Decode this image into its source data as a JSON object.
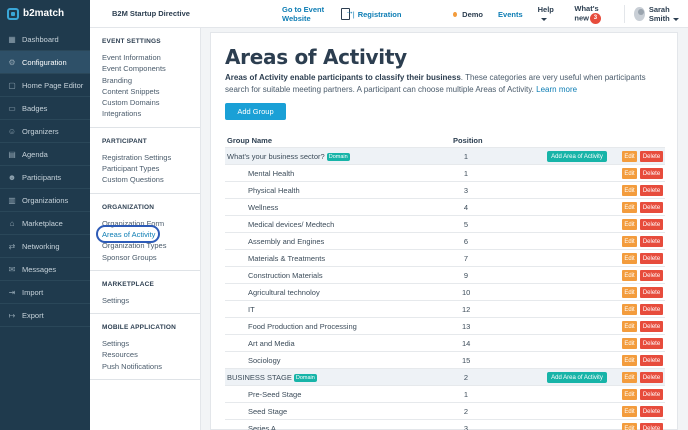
{
  "topbar": {
    "brand": "b2match",
    "event_title": "B2M Startup Directive",
    "go_to_event": "Go to Event Website",
    "registration": "Registration",
    "demo": "Demo",
    "events": "Events",
    "help": "Help",
    "whats_new": "What's new",
    "whats_new_count": "3",
    "user_name": "Sarah Smith"
  },
  "leftnav": {
    "items": [
      {
        "label": "Dashboard",
        "icon": "grid-icon"
      },
      {
        "label": "Configuration",
        "icon": "settings-icon"
      },
      {
        "label": "Home Page Editor",
        "icon": "page-icon"
      },
      {
        "label": "Badges",
        "icon": "badge-icon"
      },
      {
        "label": "Organizers",
        "icon": "people-icon"
      },
      {
        "label": "Agenda",
        "icon": "calendar-icon"
      },
      {
        "label": "Participants",
        "icon": "person-icon"
      },
      {
        "label": "Organizations",
        "icon": "building-icon"
      },
      {
        "label": "Marketplace",
        "icon": "store-icon"
      },
      {
        "label": "Networking",
        "icon": "network-icon"
      },
      {
        "label": "Messages",
        "icon": "mail-icon"
      },
      {
        "label": "Import",
        "icon": "import-icon"
      },
      {
        "label": "Export",
        "icon": "export-icon"
      }
    ]
  },
  "submenu": {
    "event_settings": {
      "title": "EVENT SETTINGS",
      "links": [
        "Event Information",
        "Event Components",
        "Branding",
        "Content Snippets",
        "Custom Domains",
        "Integrations"
      ]
    },
    "participant": {
      "title": "PARTICIPANT",
      "links": [
        "Registration Settings",
        "Participant Types",
        "Custom Questions"
      ]
    },
    "organization": {
      "title": "ORGANIZATION",
      "links": [
        "Organization Form",
        "Areas of Activity",
        "Organization Types",
        "Sponsor Groups"
      ]
    },
    "marketplace": {
      "title": "MARKETPLACE",
      "links": [
        "Settings"
      ]
    },
    "mobile": {
      "title": "MOBILE APPLICATION",
      "links": [
        "Settings",
        "Resources",
        "Push Notifications"
      ]
    }
  },
  "main": {
    "title": "Areas of Activity",
    "desc_bold": "Areas of Activity enable participants to classify their business",
    "desc_rest": ". These categories are very useful when participants search for suitable meeting partners. A participant can choose multiple Areas of Activity.",
    "learn_more": "Learn more",
    "add_group": "Add Group",
    "col_name": "Group Name",
    "col_position": "Position",
    "domain_badge": "Domain",
    "add_area": "Add Area of Activity",
    "edit": "Edit",
    "delete": "Delete",
    "rows": [
      {
        "name": "What's your business sector?",
        "position": "1",
        "group": true
      },
      {
        "name": "Mental Health",
        "position": "1"
      },
      {
        "name": "Physical Health",
        "position": "3"
      },
      {
        "name": "Wellness",
        "position": "4"
      },
      {
        "name": "Medical devices/ Medtech",
        "position": "5"
      },
      {
        "name": "Assembly and Engines",
        "position": "6"
      },
      {
        "name": "Materials & Treatments",
        "position": "7"
      },
      {
        "name": "Construction Materials",
        "position": "9"
      },
      {
        "name": "Agricultural technoloy",
        "position": "10"
      },
      {
        "name": "IT",
        "position": "12"
      },
      {
        "name": "Food Production and Processing",
        "position": "13"
      },
      {
        "name": "Art and Media",
        "position": "14"
      },
      {
        "name": "Sociology",
        "position": "15"
      },
      {
        "name": "BUSINESS STAGE",
        "position": "2",
        "group": true
      },
      {
        "name": "Pre-Seed Stage",
        "position": "1"
      },
      {
        "name": "Seed Stage",
        "position": "2"
      },
      {
        "name": "Series A",
        "position": "3"
      }
    ]
  }
}
